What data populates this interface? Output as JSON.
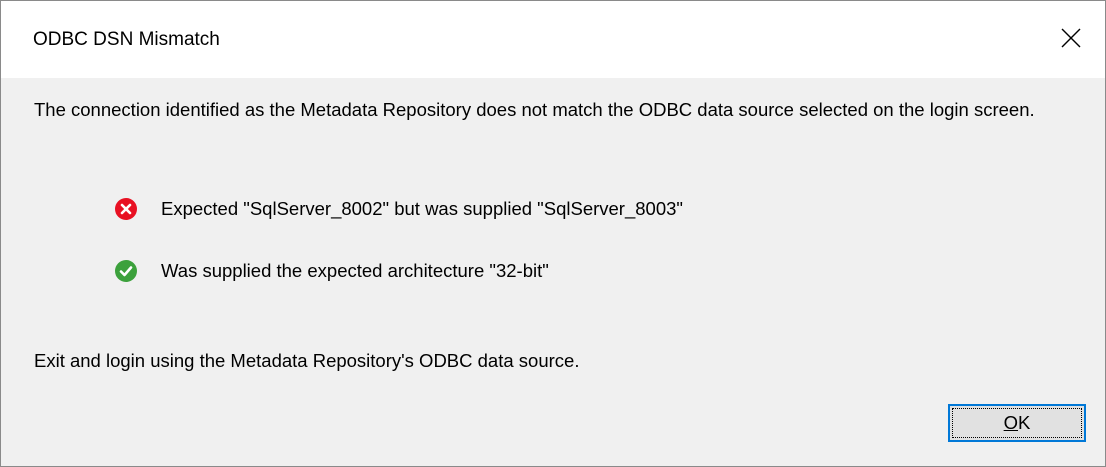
{
  "dialog": {
    "title": "ODBC DSN Mismatch",
    "close_icon": "close-icon",
    "message": "The connection identified as the Metadata Repository does not match the ODBC data source selected on the login screen.",
    "checks": [
      {
        "status": "error",
        "icon": "error-icon",
        "color": "#e81123",
        "text": "Expected \"SqlServer_8002\" but was supplied \"SqlServer_8003\""
      },
      {
        "status": "ok",
        "icon": "success-check-icon",
        "color": "#3ca13c",
        "text": "Was supplied the expected architecture \"32-bit\""
      }
    ],
    "instruction": "Exit and login using the Metadata Repository's ODBC data source.",
    "ok_button": {
      "mnemonic": "O",
      "rest": "K"
    },
    "colors": {
      "body_background": "#f0f0f0",
      "titlebar_background": "#ffffff",
      "button_focus_border": "#0078d7"
    }
  }
}
